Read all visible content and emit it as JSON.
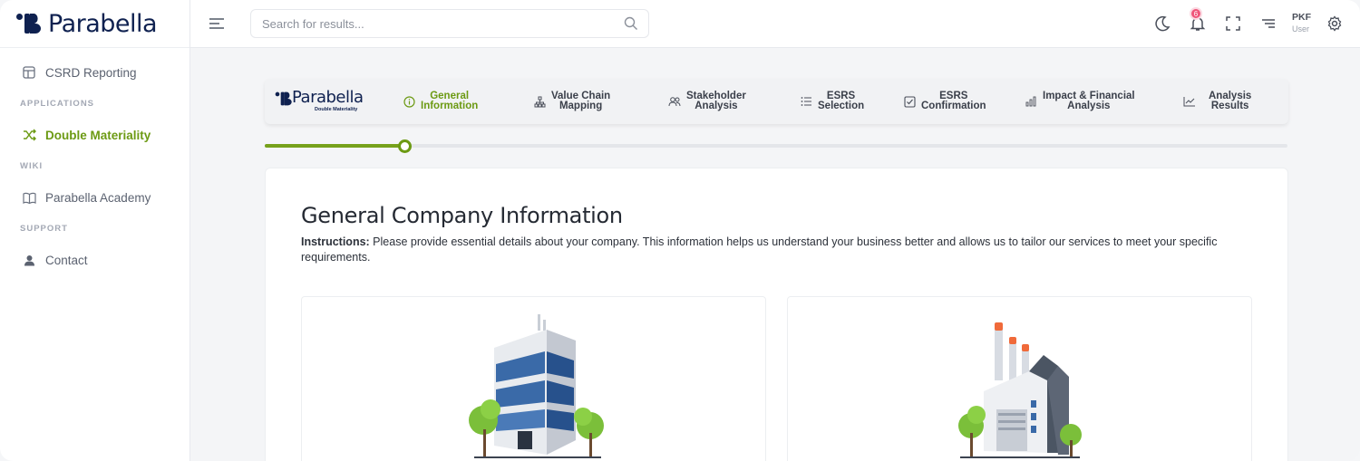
{
  "brand": {
    "name": "Parabella",
    "subtitle": "Double Materiality"
  },
  "sidebar": {
    "top_item": "CSRD Reporting",
    "sections": [
      {
        "title": "APPLICATIONS",
        "item": "Double Materiality"
      },
      {
        "title": "WIKI",
        "item": "Parabella Academy"
      },
      {
        "title": "SUPPORT",
        "item": "Contact"
      }
    ]
  },
  "header": {
    "search_placeholder": "Search for results...",
    "notification_count": "6",
    "user_name": "PKF",
    "user_role": "User"
  },
  "stepper": {
    "steps": [
      {
        "label": "General\nInformation",
        "icon": "info-icon",
        "active": true
      },
      {
        "label": "Value Chain\nMapping",
        "icon": "hierarchy-icon",
        "active": false
      },
      {
        "label": "Stakeholder\nAnalysis",
        "icon": "people-icon",
        "active": false
      },
      {
        "label": "ESRS\nSelection",
        "icon": "list-icon",
        "active": false
      },
      {
        "label": "ESRS\nConfirmation",
        "icon": "checkbox-icon",
        "active": false
      },
      {
        "label": "Impact & Financial\nAnalysis",
        "icon": "bar-chart-icon",
        "active": false
      },
      {
        "label": "Analysis\nResults",
        "icon": "line-chart-icon",
        "active": false
      }
    ],
    "progress_fraction": 0.138
  },
  "content": {
    "title": "General Company Information",
    "instructions_label": "Instructions:",
    "instructions_text": " Please provide essential details about your company. This information helps us understand your business better and allows us to tailor our services to meet your specific requirements.",
    "options": [
      {
        "icon": "office-building-icon"
      },
      {
        "icon": "factory-icon"
      }
    ]
  },
  "colors": {
    "accent": "#6c9a13",
    "brand_navy": "#0f2150",
    "badge": "#ef5479"
  }
}
